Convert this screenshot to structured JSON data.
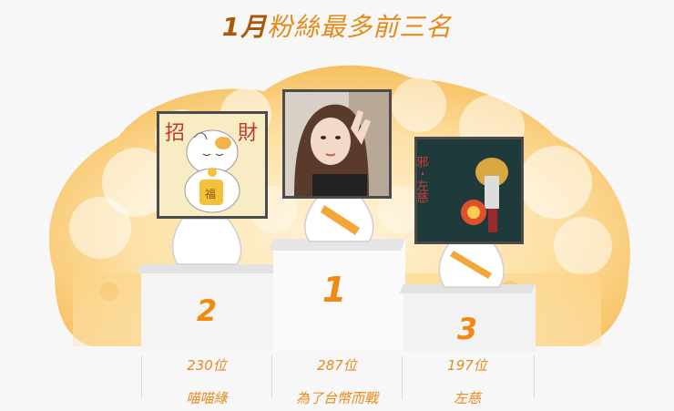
{
  "title": {
    "month": "1月",
    "text": "粉絲最多前三名"
  },
  "winners": [
    {
      "rank": "2",
      "count": "230位",
      "name": "喵喵綠",
      "avatar": "lucky-cat-avatar",
      "badge_left": "招",
      "badge_right": "財",
      "badge_mid": "福"
    },
    {
      "rank": "1",
      "count": "287位",
      "name": "為了台幣而戰",
      "avatar": "girl-selfie-avatar"
    },
    {
      "rank": "3",
      "count": "197位",
      "name": "左慈",
      "avatar": "game-character-avatar",
      "caption": "邪・左慈"
    }
  ],
  "colors": {
    "accent": "#f08a12",
    "title_month": "#a85a0a",
    "cloud": "#fcd58a"
  }
}
